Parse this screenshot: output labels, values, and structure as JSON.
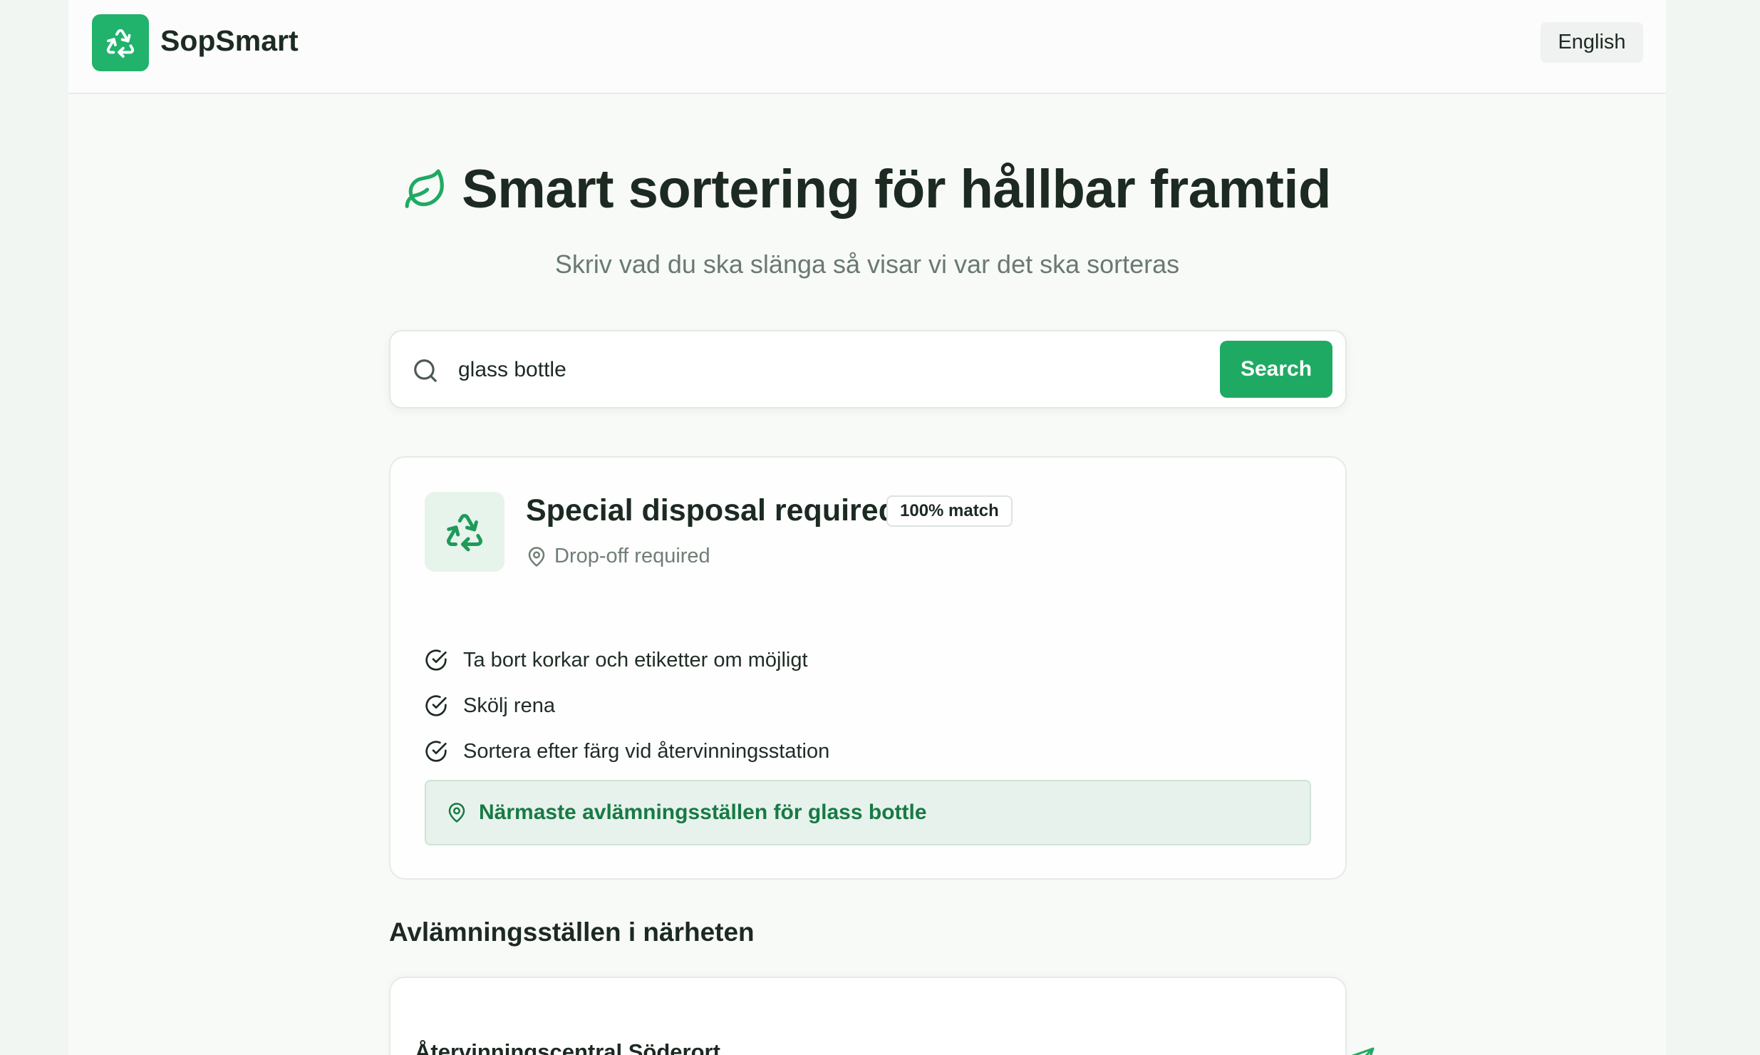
{
  "header": {
    "brand": "SopSmart",
    "logo_icon": "recycle-icon",
    "language_button": "English"
  },
  "hero": {
    "icon": "leaf-icon",
    "title": "Smart sortering för hållbar framtid",
    "subtitle": "Skriv vad du ska slänga så visar vi var det ska sorteras"
  },
  "search": {
    "value": "glass bottle",
    "button_label": "Search",
    "icon": "search-icon"
  },
  "result": {
    "icon": "recycle-icon",
    "title": "Special disposal required",
    "match_badge": "100% match",
    "subline": "Drop-off required",
    "tips": [
      "Ta bort korkar och etiketter om möjligt",
      "Skölj rena",
      "Sortera efter färg vid återvinningsstation"
    ],
    "nearest_button": "Närmaste avlämningsställen för glass bottle"
  },
  "dropoff": {
    "section_title": "Avlämningsställen i närheten",
    "stations": [
      {
        "name": "Återvinningscentral Söderort"
      }
    ]
  },
  "colors": {
    "accent": "#1faa63",
    "accent_dark": "#177a45",
    "accent_soft": "#e6f4ec",
    "text": "#1c2a22",
    "muted": "#6a7a70"
  }
}
